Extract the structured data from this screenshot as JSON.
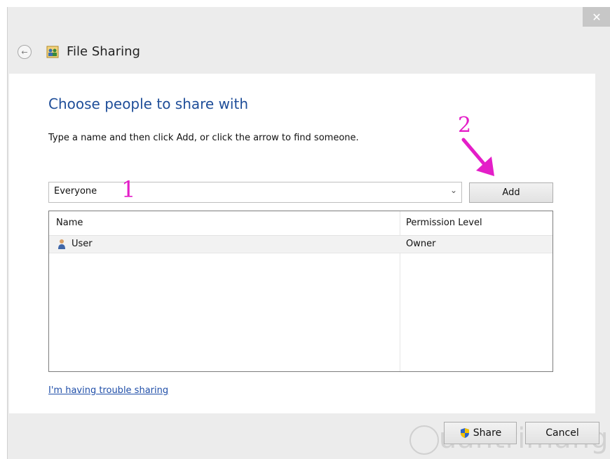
{
  "window": {
    "title": "File Sharing",
    "close_glyph": "✕",
    "back_glyph": "←"
  },
  "content": {
    "heading": "Choose people to share with",
    "instruction": "Type a name and then click Add, or click the arrow to find someone.",
    "combo": {
      "value": "Everyone",
      "arrow": "⌄"
    },
    "add_label": "Add"
  },
  "table": {
    "columns": [
      "Name",
      "Permission Level"
    ],
    "rows": [
      {
        "name": "User",
        "permission": "Owner"
      }
    ]
  },
  "trouble_link": "I'm having trouble sharing",
  "buttons": {
    "share": "Share",
    "cancel": "Cancel"
  },
  "annotations": {
    "step1": "1",
    "step2": "2",
    "color": "#e41ec8"
  },
  "watermark": "uantrimang",
  "colors": {
    "heading": "#1f4e99",
    "link": "#1f4ea8",
    "chrome": "#ececec"
  }
}
